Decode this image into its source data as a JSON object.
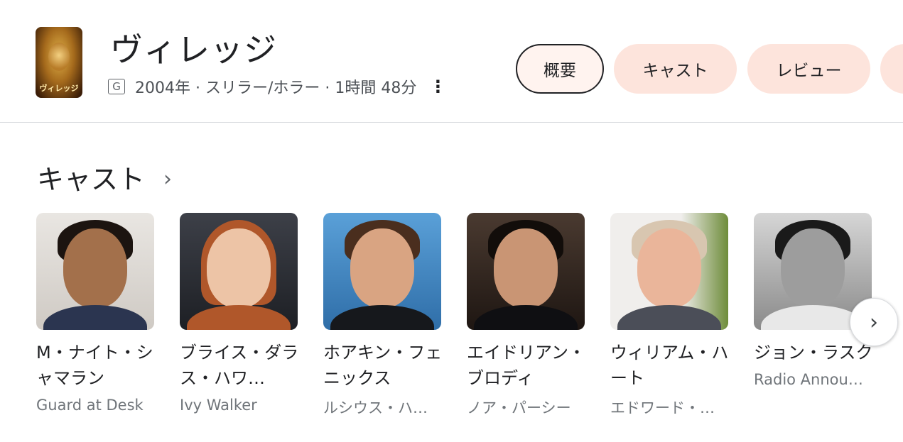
{
  "movie": {
    "poster_label": "ヴィレッジ",
    "title": "ヴィレッジ",
    "rating": "G",
    "meta": "2004年 · スリラー/ホラー · 1時間 48分",
    "more_icon": "⋮"
  },
  "tabs": [
    {
      "label": "概要",
      "selected": true
    },
    {
      "label": "キャスト",
      "selected": false
    },
    {
      "label": "レビュー",
      "selected": false
    }
  ],
  "cast": {
    "title": "キャスト",
    "chevron": "›",
    "next_icon": "›",
    "members": [
      {
        "name": "M・ナイト・シャマラン",
        "role": "Guard at Desk"
      },
      {
        "name": "ブライス・ダラス・ハワ…",
        "role": "Ivy Walker"
      },
      {
        "name": "ホアキン・フェニックス",
        "role": "ルシウス・ハ…"
      },
      {
        "name": "エイドリアン・ブロディ",
        "role": "ノア・パーシー"
      },
      {
        "name": "ウィリアム・ハート",
        "role": "エドワード・…"
      },
      {
        "name": "ジョン・ラスク",
        "role": "Radio Annou…"
      }
    ]
  }
}
